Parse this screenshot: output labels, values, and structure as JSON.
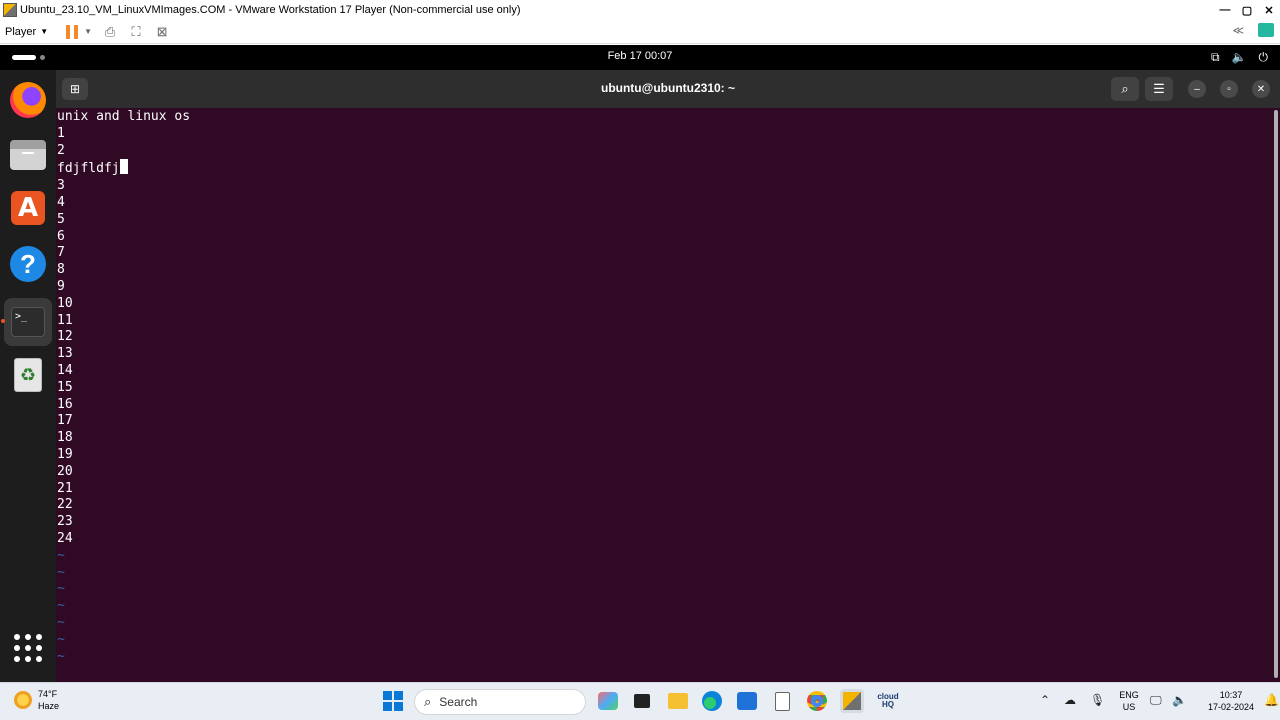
{
  "vmware": {
    "window_title": "Ubuntu_23.10_VM_LinuxVMImages.COM - VMware Workstation 17 Player (Non-commercial use only)",
    "player_menu": "Player",
    "window_controls": {
      "minimize": "—",
      "maximize": "▢",
      "close": "✕"
    }
  },
  "ubuntu_topbar": {
    "clock": "Feb 17  00:07"
  },
  "terminal": {
    "title": "ubuntu@ubuntu2310: ~",
    "line_first": "unix and linux os",
    "line_1": "1",
    "line_2": "2",
    "cursor_line": "fdjfldfj",
    "numbers": [
      "3",
      "4",
      "5",
      "6",
      "7",
      "8",
      "9",
      "10",
      "11",
      "12",
      "13",
      "14",
      "15",
      "16",
      "17",
      "18",
      "19",
      "20",
      "21",
      "22",
      "23",
      "24"
    ],
    "tildes": [
      "~",
      "~",
      "~",
      "~",
      "~",
      "~",
      "~"
    ]
  },
  "taskbar": {
    "weather_temp": "74°F",
    "weather_desc": "Haze",
    "search_label": "Search",
    "lang_line1": "ENG",
    "lang_line2": "US",
    "time": "10:37",
    "date": "17-02-2024"
  },
  "colors": {
    "terminal_bg": "#300a24",
    "terminal_header": "#2e2e2e",
    "ubuntu_accent": "#e95420",
    "tilde_blue": "#3465a4"
  }
}
